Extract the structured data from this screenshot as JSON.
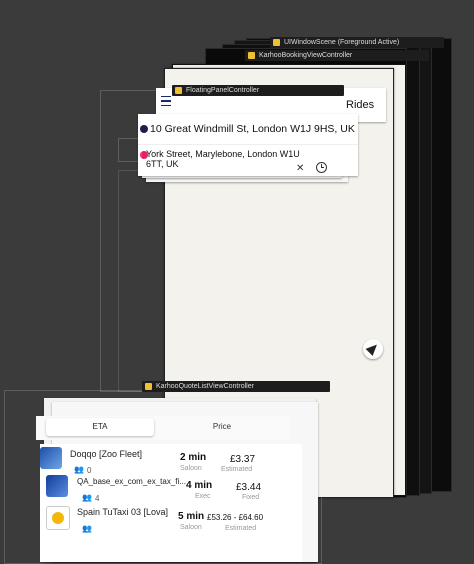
{
  "scene": {
    "top_window_label": "UIWindowScene (Foreground Active)",
    "booking_vc_label": "KarhooBookingViewController",
    "floating_vc_label": "FloatingPanelController",
    "quote_vc_label": "KarhooQuoteListViewController"
  },
  "header": {
    "title": "Rides"
  },
  "address_bar": {
    "pickup": "10 Great Windmill St, London W1J 9HS, UK",
    "dropoff": "York Street, Marylebone, London W1U 6TT, UK",
    "pickup_color": "#1b1f4a",
    "dropoff_color": "#e91e63"
  },
  "sort_tabs": {
    "eta": "ETA",
    "price": "Price"
  },
  "quotes": [
    {
      "name": "Doqqo [Zoo Fleet]",
      "time": "2 min",
      "category": "Saloon",
      "price": "£3.37",
      "price_type": "Estimated",
      "pax": "0"
    },
    {
      "name": "QA_base_ex_com_ex_tax_fi...",
      "time": "4 min",
      "category": "Exec",
      "price": "£3.44",
      "price_type": "Fixed",
      "pax": "4"
    },
    {
      "name": "Spain TuTaxi 03 [Lova]",
      "time": "5 min",
      "category": "Saloon",
      "price": "£53.26 - £64.60",
      "price_type": "Estimated",
      "pax": ""
    }
  ],
  "icons": {
    "menu": "hamburger-menu-icon",
    "clear": "close-icon",
    "prebook": "clock-icon",
    "locate": "location-arrow-icon",
    "passenger": "passenger-icon"
  }
}
